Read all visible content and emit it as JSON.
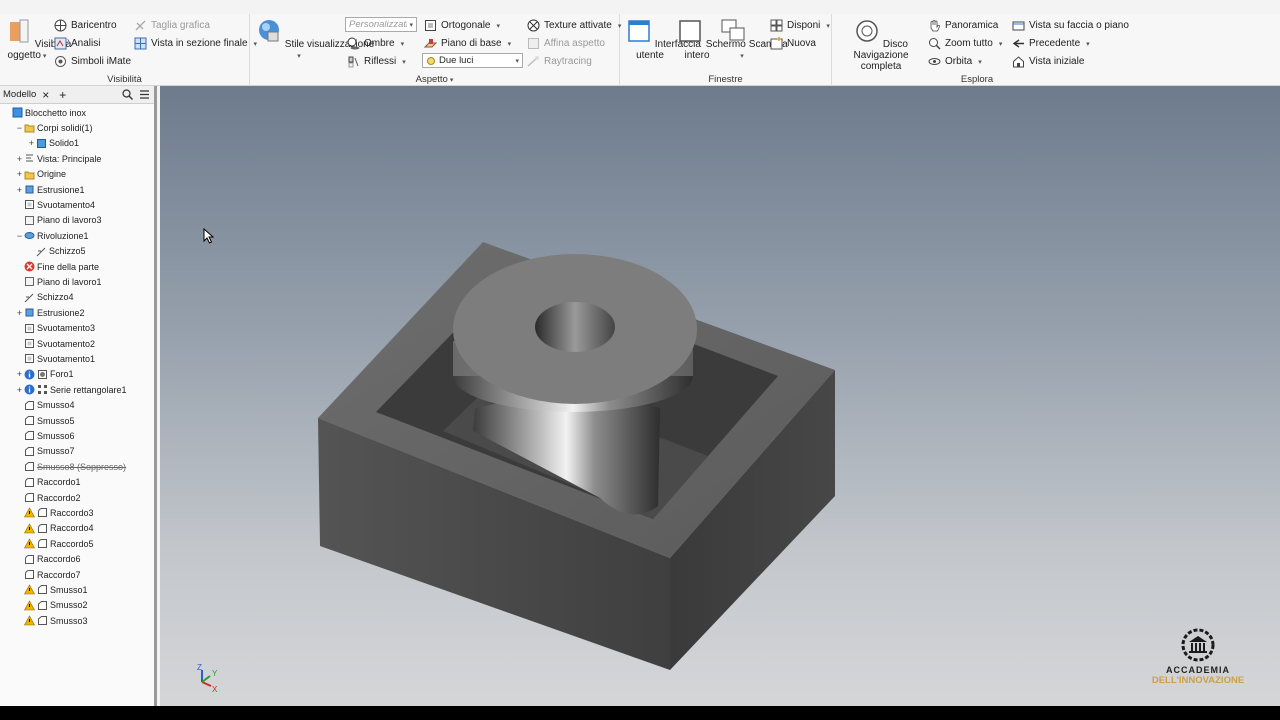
{
  "ribbon": {
    "visibility_group": {
      "title": "Visibilità",
      "object_visibility": "Visibilità\noggetto",
      "baricentro": "Baricentro",
      "analisi": "Analisi",
      "simboli_imate": "Simboli iMate",
      "taglia_grafica": "Taglia grafica",
      "vista_sezione": "Vista in sezione finale"
    },
    "appearance_group": {
      "title": "Aspetto",
      "stile_visualizzazione": "Stile visualizzazione",
      "personalizzato": "Personalizzati",
      "ortogonale": "Ortogonale",
      "ombre": "Ombre",
      "piano_base": "Piano di base",
      "riflessi": "Riflessi",
      "due_luci": "Due luci",
      "texture": "Texture attivate",
      "affina": "Affina aspetto",
      "raytracing": "Raytracing"
    },
    "windows_group": {
      "title": "Finestre",
      "interfaccia_utente": "Interfaccia\nutente",
      "schermo_intero": "Schermo\nintero",
      "scambia": "Scambia",
      "disponi": "Disponi",
      "nuova": "Nuova"
    },
    "explore_group": {
      "title": "Esplora",
      "disco_navigazione": "Disco Navigazione\ncompleta",
      "panoramica": "Panoramica",
      "zoom_tutto": "Zoom tutto",
      "orbita": "Orbita",
      "vista_faccia": "Vista su faccia o piano",
      "precedente": "Precedente",
      "vista_iniziale": "Vista iniziale"
    }
  },
  "panel": {
    "tab_label": "Modello",
    "close_symbol": "×",
    "add_symbol": "+"
  },
  "tree": [
    {
      "label": "Blocchetto inox",
      "icon": "part-icon",
      "indent": 0,
      "exp": "",
      "warn": false
    },
    {
      "label": "Corpi solidi(1)",
      "icon": "folder-icon",
      "indent": 1,
      "exp": "−",
      "warn": false
    },
    {
      "label": "Solido1",
      "icon": "solid-icon",
      "indent": 2,
      "exp": "+",
      "warn": false
    },
    {
      "label": "Vista: Principale",
      "icon": "view-icon",
      "indent": 1,
      "exp": "+",
      "warn": false
    },
    {
      "label": "Origine",
      "icon": "folder-icon",
      "indent": 1,
      "exp": "+",
      "warn": false
    },
    {
      "label": "Estrusione1",
      "icon": "extrude-icon",
      "indent": 1,
      "exp": "+",
      "warn": false
    },
    {
      "label": "Svuotamento4",
      "icon": "shell-icon",
      "indent": 1,
      "exp": "",
      "warn": false
    },
    {
      "label": "Piano di lavoro3",
      "icon": "workplane-icon",
      "indent": 1,
      "exp": "",
      "warn": false
    },
    {
      "label": "Rivoluzione1",
      "icon": "revolve-icon",
      "indent": 1,
      "exp": "−",
      "warn": false
    },
    {
      "label": "Schizzo5",
      "icon": "sketch-icon",
      "indent": 2,
      "exp": "",
      "warn": false
    },
    {
      "label": "Fine della parte",
      "icon": "end-of-part-icon",
      "indent": 1,
      "exp": "",
      "warn": false
    },
    {
      "label": "Piano di lavoro1",
      "icon": "workplane-icon",
      "indent": 1,
      "exp": "",
      "warn": false
    },
    {
      "label": "Schizzo4",
      "icon": "sketch-icon",
      "indent": 1,
      "exp": "",
      "warn": false
    },
    {
      "label": "Estrusione2",
      "icon": "extrude-icon",
      "indent": 1,
      "exp": "+",
      "warn": false
    },
    {
      "label": "Svuotamento3",
      "icon": "shell-icon",
      "indent": 1,
      "exp": "",
      "warn": false
    },
    {
      "label": "Svuotamento2",
      "icon": "shell-icon",
      "indent": 1,
      "exp": "",
      "warn": false
    },
    {
      "label": "Svuotamento1",
      "icon": "shell-icon",
      "indent": 1,
      "exp": "",
      "warn": false
    },
    {
      "label": "Foro1",
      "icon": "hole-icon",
      "indent": 1,
      "exp": "+",
      "warn": false,
      "info": true
    },
    {
      "label": "Serie rettangolare1",
      "icon": "pattern-icon",
      "indent": 1,
      "exp": "+",
      "warn": false,
      "info": true
    },
    {
      "label": "Smusso4",
      "icon": "chamfer-icon",
      "indent": 1,
      "exp": "",
      "warn": false
    },
    {
      "label": "Smusso5",
      "icon": "chamfer-icon",
      "indent": 1,
      "exp": "",
      "warn": false
    },
    {
      "label": "Smusso6",
      "icon": "chamfer-icon",
      "indent": 1,
      "exp": "",
      "warn": false
    },
    {
      "label": "Smusso7",
      "icon": "chamfer-icon",
      "indent": 1,
      "exp": "",
      "warn": false
    },
    {
      "label": "Smusso8 (Soppresso)",
      "icon": "chamfer-icon",
      "indent": 1,
      "exp": "",
      "warn": false,
      "suppressed": true
    },
    {
      "label": "Raccordo1",
      "icon": "fillet-icon",
      "indent": 1,
      "exp": "",
      "warn": false
    },
    {
      "label": "Raccordo2",
      "icon": "fillet-icon",
      "indent": 1,
      "exp": "",
      "warn": false
    },
    {
      "label": "Raccordo3",
      "icon": "fillet-icon",
      "indent": 1,
      "exp": "",
      "warn": true
    },
    {
      "label": "Raccordo4",
      "icon": "fillet-icon",
      "indent": 1,
      "exp": "",
      "warn": true
    },
    {
      "label": "Raccordo5",
      "icon": "fillet-icon",
      "indent": 1,
      "exp": "",
      "warn": true
    },
    {
      "label": "Raccordo6",
      "icon": "fillet-icon",
      "indent": 1,
      "exp": "",
      "warn": false
    },
    {
      "label": "Raccordo7",
      "icon": "fillet-icon",
      "indent": 1,
      "exp": "",
      "warn": false
    },
    {
      "label": "Smusso1",
      "icon": "chamfer-icon",
      "indent": 1,
      "exp": "",
      "warn": true
    },
    {
      "label": "Smusso2",
      "icon": "chamfer-icon",
      "indent": 1,
      "exp": "",
      "warn": true
    },
    {
      "label": "Smusso3",
      "icon": "chamfer-icon",
      "indent": 1,
      "exp": "",
      "warn": true
    }
  ],
  "viewport": {
    "watermark_line1": "ACCADEMIA",
    "watermark_line2": "DELL'INNOVAZIONE",
    "axis_z": "Z",
    "axis_x": "X",
    "axis_y": "Y"
  },
  "colors": {
    "accent_blue": "#2a7fd0",
    "warning": "#f0b400",
    "end_of_part": "#d83b2c",
    "watermark_gold": "#c9a14a"
  }
}
